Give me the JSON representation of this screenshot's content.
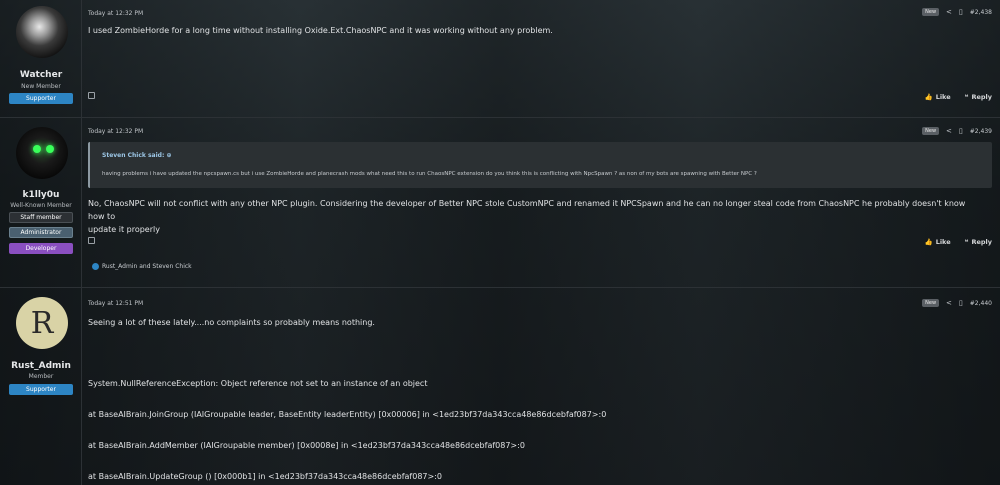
{
  "posts": [
    {
      "user": {
        "name": "Watcher",
        "title": "New Member",
        "roles": [
          "Supporter"
        ]
      },
      "date": "Today at 12:32 PM",
      "badge": "New",
      "number": "#2,438",
      "message": "I used ZombieHorde for a long time without installing Oxide.Ext.ChaosNPC and it was working without any problem.",
      "like_label": "Like",
      "reply_label": "Reply"
    },
    {
      "user": {
        "name": "k1lly0u",
        "title": "Well-Known Member",
        "roles": [
          "Staff member",
          "Administrator",
          "Developer"
        ]
      },
      "date": "Today at 12:32 PM",
      "badge": "New",
      "number": "#2,439",
      "quote": {
        "author": "Steven Chick said:",
        "text": "having problems i have updated the npcspawn.cs but i use ZombieHorde and planecrash mods what need this to run ChaosNPC extension do you think this is conflicting with NpcSpawn ? as non of my bots are spawning with Better NPC ?"
      },
      "message_line1": "No, ChaosNPC will not conflict with any other NPC plugin. Considering the developer of Better NPC stole CustomNPC and renamed it NPCSpawn and he can no longer steal code from ChaosNPC he probably doesn't know how to",
      "message_line2": "update it properly",
      "like_label": "Like",
      "reply_label": "Reply",
      "reactions": "Rust_Admin and Steven Chick"
    },
    {
      "user": {
        "name": "Rust_Admin",
        "title": "Member",
        "roles": [
          "Supporter"
        ],
        "avatar_letter": "R"
      },
      "date": "Today at 12:51 PM",
      "badge": "New",
      "number": "#2,440",
      "lines": [
        "Seeing a lot of these lately....no complaints so probably means nothing.",
        "System.NullReferenceException: Object reference not set to an instance of an object",
        "at BaseAIBrain.JoinGroup (IAIGroupable leader, BaseEntity leaderEntity) [0x00006] in <1ed23bf37da343cca48e86dcebfaf087>:0",
        "at BaseAIBrain.AddMember (IAIGroupable member) [0x0008e] in <1ed23bf37da343cca48e86dcebfaf087>:0",
        "at BaseAIBrain.UpdateGroup () [0x000b1] in <1ed23bf37da343cca48e86dcebfaf087>:0"
      ]
    }
  ],
  "icons": {
    "share": "share-icon",
    "bookmark": "bookmark-icon",
    "like": "thumbs-up-icon",
    "reply": "reply-icon"
  }
}
